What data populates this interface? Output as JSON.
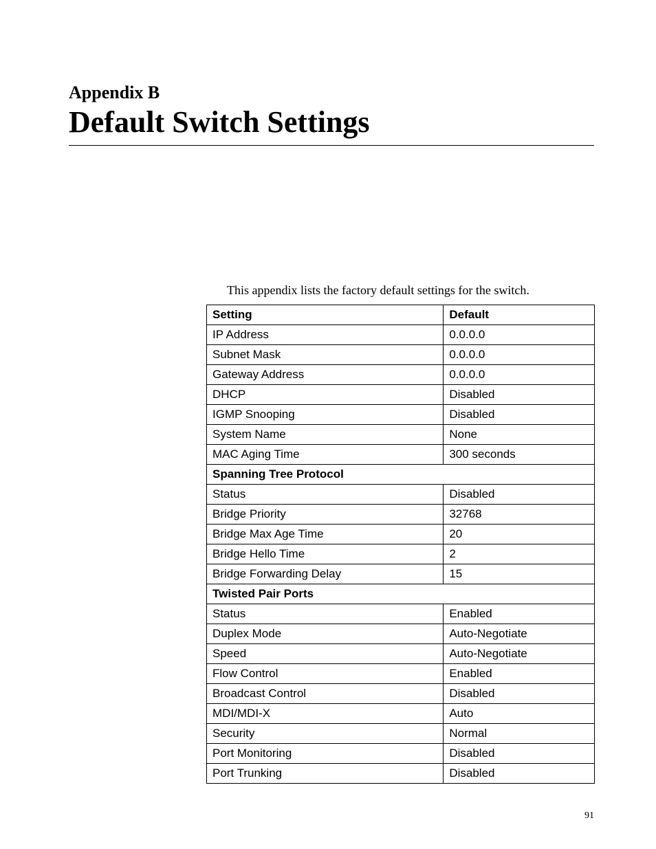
{
  "appendix_label": "Appendix B",
  "main_title": "Default Switch Settings",
  "intro_text": "This appendix lists the factory default settings for the switch.",
  "table": {
    "header_setting": "Setting",
    "header_default": "Default",
    "rows": [
      {
        "type": "row",
        "setting": "IP Address",
        "default": "0.0.0.0"
      },
      {
        "type": "row",
        "setting": "Subnet Mask",
        "default": "0.0.0.0"
      },
      {
        "type": "row",
        "setting": "Gateway Address",
        "default": "0.0.0.0"
      },
      {
        "type": "row",
        "setting": "DHCP",
        "default": "Disabled"
      },
      {
        "type": "row",
        "setting": "IGMP Snooping",
        "default": "Disabled"
      },
      {
        "type": "row",
        "setting": "System Name",
        "default": "None"
      },
      {
        "type": "row",
        "setting": "MAC Aging Time",
        "default": "300 seconds"
      },
      {
        "type": "section",
        "setting": "Spanning Tree Protocol"
      },
      {
        "type": "row",
        "setting": "Status",
        "default": "Disabled"
      },
      {
        "type": "row",
        "setting": "Bridge Priority",
        "default": "32768"
      },
      {
        "type": "row",
        "setting": "Bridge Max Age Time",
        "default": "20"
      },
      {
        "type": "row",
        "setting": "Bridge Hello Time",
        "default": "2"
      },
      {
        "type": "row",
        "setting": "Bridge Forwarding Delay",
        "default": "15"
      },
      {
        "type": "section",
        "setting": "Twisted Pair Ports"
      },
      {
        "type": "row",
        "setting": "Status",
        "default": "Enabled"
      },
      {
        "type": "row",
        "setting": "Duplex Mode",
        "default": "Auto-Negotiate"
      },
      {
        "type": "row",
        "setting": "Speed",
        "default": "Auto-Negotiate"
      },
      {
        "type": "row",
        "setting": "Flow Control",
        "default": "Enabled"
      },
      {
        "type": "row",
        "setting": "Broadcast Control",
        "default": "Disabled"
      },
      {
        "type": "row",
        "setting": "MDI/MDI-X",
        "default": "Auto"
      },
      {
        "type": "row",
        "setting": "Security",
        "default": "Normal"
      },
      {
        "type": "row",
        "setting": "Port Monitoring",
        "default": "Disabled"
      },
      {
        "type": "row",
        "setting": "Port Trunking",
        "default": "Disabled"
      }
    ]
  },
  "page_number": "91"
}
